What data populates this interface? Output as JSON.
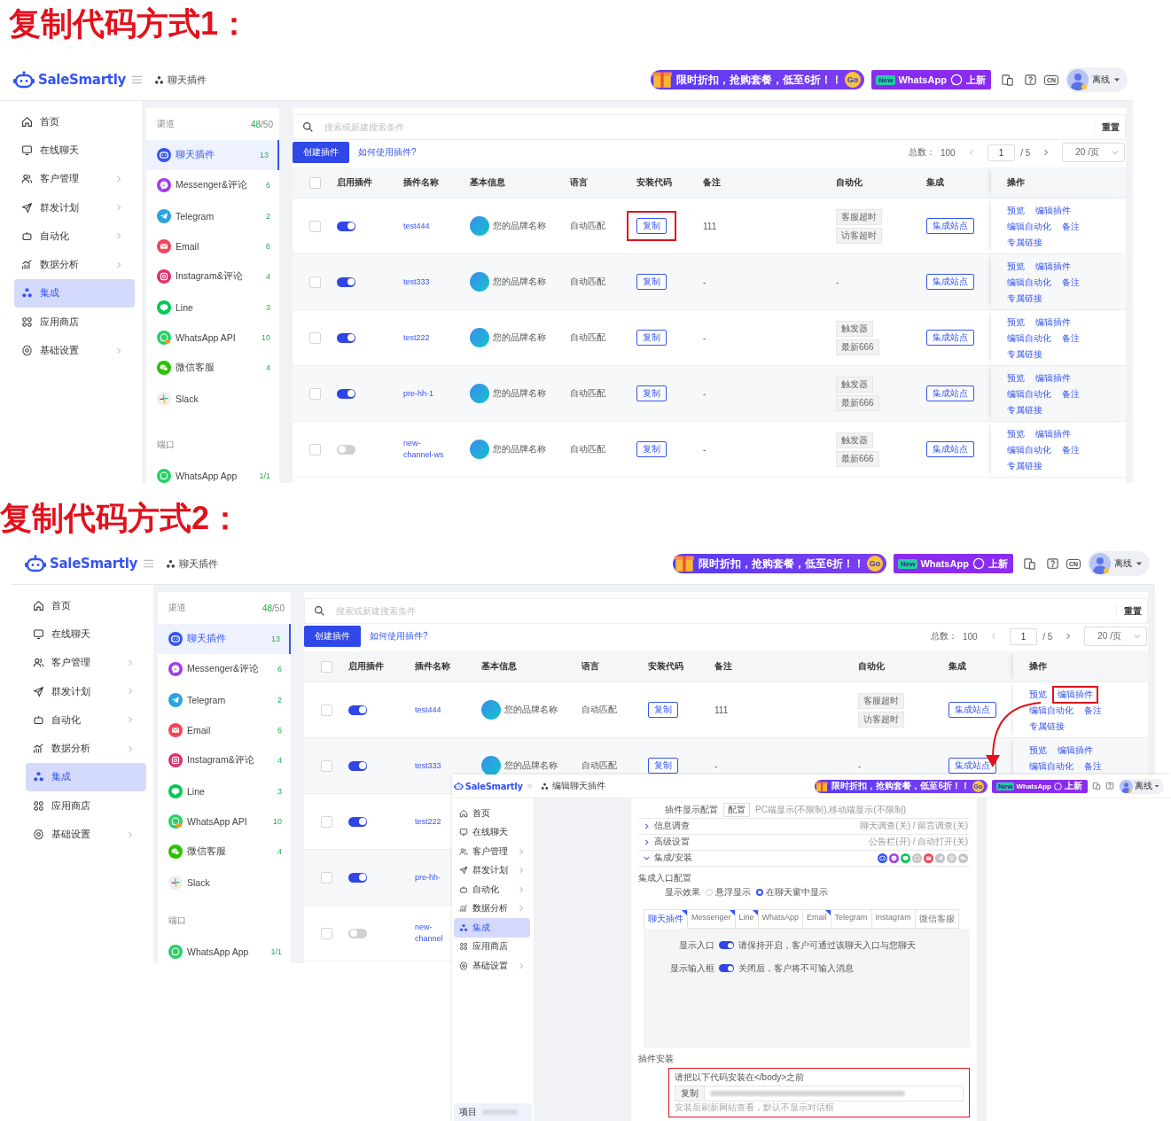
{
  "headings": [
    "复制代码方式1：",
    "复制代码方式2："
  ],
  "screens": [
    {
      "brand": "SaleSmartly",
      "breadcrumb": "聊天插件",
      "promo": {
        "text": "限时折扣，抢购套餐，低至6折！！",
        "go": "Go"
      },
      "whatsapp_promo": {
        "badge": "New",
        "text": "WhatsApp",
        "suffix": "上新"
      },
      "language": "CN",
      "user_status": "离线",
      "nav": [
        {
          "kind": "home",
          "label": "首页",
          "has_submenu": false,
          "selected": false
        },
        {
          "kind": "chat",
          "label": "在线聊天",
          "has_submenu": false,
          "selected": false
        },
        {
          "kind": "users",
          "label": "客户管理",
          "has_submenu": true,
          "selected": false
        },
        {
          "kind": "send",
          "label": "群发计划",
          "has_submenu": true,
          "selected": false
        },
        {
          "kind": "robot",
          "label": "自动化",
          "has_submenu": true,
          "selected": false
        },
        {
          "kind": "chart",
          "label": "数据分析",
          "has_submenu": true,
          "selected": false
        },
        {
          "kind": "integration",
          "label": "集成",
          "has_submenu": false,
          "selected": true
        },
        {
          "kind": "apps",
          "label": "应用商店",
          "has_submenu": false,
          "selected": false
        },
        {
          "kind": "settings",
          "label": "基础设置",
          "has_submenu": true,
          "selected": false
        }
      ],
      "channels": {
        "title": "渠道",
        "used": "48",
        "limit": "/50",
        "items": [
          {
            "kind": "chat",
            "label": "聊天插件",
            "count": "13",
            "selected": true
          },
          {
            "kind": "messenger",
            "label": "Messenger&评论",
            "count": "6",
            "selected": false
          },
          {
            "kind": "telegram",
            "label": "Telegram",
            "count": "2",
            "selected": false
          },
          {
            "kind": "email",
            "label": "Email",
            "count": "6",
            "selected": false
          },
          {
            "kind": "instagram",
            "label": "Instagram&评论",
            "count": "4",
            "selected": false
          },
          {
            "kind": "line",
            "label": "Line",
            "count": "3",
            "selected": false
          },
          {
            "kind": "whatsappapi",
            "label": "WhatsApp API",
            "count": "10",
            "selected": false
          },
          {
            "kind": "wechat",
            "label": "微信客服",
            "count": "4",
            "selected": false
          },
          {
            "kind": "slack",
            "label": "Slack",
            "selected": false
          }
        ],
        "ports_title": "端口",
        "ports": [
          {
            "kind": "whatsapp",
            "label": "WhatsApp App",
            "count": "1/1",
            "selected": false
          }
        ]
      },
      "search": {
        "placeholder": "搜索或新建搜索条件",
        "reset": "重置"
      },
      "create_button": "创建插件",
      "help_link": "如何使用插件?",
      "pagination": {
        "total_label": "总数：",
        "total": "100",
        "page": "1",
        "pages": "/ 5",
        "page_size": "20 /页"
      },
      "all_checked": false,
      "columns": [
        "启用插件",
        "插件名称",
        "基本信息",
        "语言",
        "安装代码",
        "备注",
        "自动化",
        "集成",
        "操作"
      ],
      "rows": [
        {
          "checked": false,
          "enabled": true,
          "name": "test444",
          "brand": "您的品牌名称",
          "language": "自动匹配",
          "install": {
            "label": "复制",
            "highlighted": true
          },
          "note": "111",
          "automation": [
            "客服超时",
            "访客超时"
          ],
          "integration": "集成站点",
          "actions": [
            {
              "label": "预览",
              "highlighted": false
            },
            {
              "label": "编辑插件",
              "highlighted": false
            },
            {
              "label": "编辑自动化",
              "highlighted": false
            },
            {
              "label": "备注",
              "highlighted": false
            },
            {
              "label": "专属链接",
              "highlighted": false
            }
          ]
        },
        {
          "checked": false,
          "enabled": true,
          "name": "test333",
          "brand": "您的品牌名称",
          "language": "自动匹配",
          "install": {
            "label": "复制",
            "highlighted": false
          },
          "note": "-",
          "automation": "-",
          "integration": "集成站点",
          "actions": [
            {
              "label": "预览",
              "highlighted": false
            },
            {
              "label": "编辑插件",
              "highlighted": false
            },
            {
              "label": "编辑自动化",
              "highlighted": false
            },
            {
              "label": "备注",
              "highlighted": false
            },
            {
              "label": "专属链接",
              "highlighted": false
            }
          ]
        },
        {
          "checked": false,
          "enabled": true,
          "name": "test222",
          "brand": "您的品牌名称",
          "language": "自动匹配",
          "install": {
            "label": "复制",
            "highlighted": false
          },
          "note": "-",
          "automation": [
            "触发器",
            "最新666"
          ],
          "integration": "集成站点",
          "actions": [
            {
              "label": "预览",
              "highlighted": false
            },
            {
              "label": "编辑插件",
              "highlighted": false
            },
            {
              "label": "编辑自动化",
              "highlighted": false
            },
            {
              "label": "备注",
              "highlighted": false
            },
            {
              "label": "专属链接",
              "highlighted": false
            }
          ]
        },
        {
          "checked": false,
          "enabled": true,
          "name": "pre-hh-1",
          "brand": "您的品牌名称",
          "language": "自动匹配",
          "install": {
            "label": "复制",
            "highlighted": false
          },
          "note": "-",
          "automation": [
            "触发器",
            "最新666"
          ],
          "integration": "集成站点",
          "actions": [
            {
              "label": "预览",
              "highlighted": false
            },
            {
              "label": "编辑插件",
              "highlighted": false
            },
            {
              "label": "编辑自动化",
              "highlighted": false
            },
            {
              "label": "备注",
              "highlighted": false
            },
            {
              "label": "专属链接",
              "highlighted": false
            }
          ]
        },
        {
          "checked": false,
          "enabled": false,
          "name": "new-channel-ws",
          "brand": "您的品牌名称",
          "language": "自动匹配",
          "install": {
            "label": "复制",
            "highlighted": false
          },
          "note": "-",
          "automation": [
            "触发器",
            "最新666"
          ],
          "integration": "集成站点",
          "actions": [
            {
              "label": "预览",
              "highlighted": false
            },
            {
              "label": "编辑插件",
              "highlighted": false
            },
            {
              "label": "编辑自动化",
              "highlighted": false
            },
            {
              "label": "备注",
              "highlighted": false
            },
            {
              "label": "专属链接",
              "highlighted": false
            }
          ]
        }
      ]
    },
    {
      "brand": "SaleSmartly",
      "breadcrumb": "聊天插件",
      "promo": {
        "text": "限时折扣，抢购套餐，低至6折！！",
        "go": "Go"
      },
      "whatsapp_promo": {
        "badge": "New",
        "text": "WhatsApp",
        "suffix": "上新"
      },
      "language": "CN",
      "user_status": "离线",
      "nav": [
        {
          "kind": "home",
          "label": "首页",
          "has_submenu": false,
          "selected": false
        },
        {
          "kind": "chat",
          "label": "在线聊天",
          "has_submenu": false,
          "selected": false
        },
        {
          "kind": "users",
          "label": "客户管理",
          "has_submenu": true,
          "selected": false
        },
        {
          "kind": "send",
          "label": "群发计划",
          "has_submenu": true,
          "selected": false
        },
        {
          "kind": "robot",
          "label": "自动化",
          "has_submenu": true,
          "selected": false
        },
        {
          "kind": "chart",
          "label": "数据分析",
          "has_submenu": true,
          "selected": false
        },
        {
          "kind": "integration",
          "label": "集成",
          "has_submenu": false,
          "selected": true
        },
        {
          "kind": "apps",
          "label": "应用商店",
          "has_submenu": false,
          "selected": false
        },
        {
          "kind": "settings",
          "label": "基础设置",
          "has_submenu": true,
          "selected": false
        }
      ],
      "channels": {
        "title": "渠道",
        "used": "48",
        "limit": "/50",
        "items": [
          {
            "kind": "chat",
            "label": "聊天插件",
            "count": "13",
            "selected": true
          },
          {
            "kind": "messenger",
            "label": "Messenger&评论",
            "count": "6",
            "selected": false
          },
          {
            "kind": "telegram",
            "label": "Telegram",
            "count": "2",
            "selected": false
          },
          {
            "kind": "email",
            "label": "Email",
            "count": "6",
            "selected": false
          },
          {
            "kind": "instagram",
            "label": "Instagram&评论",
            "count": "4",
            "selected": false
          },
          {
            "kind": "line",
            "label": "Line",
            "count": "3",
            "selected": false
          },
          {
            "kind": "whatsappapi",
            "label": "WhatsApp API",
            "count": "10",
            "selected": false
          },
          {
            "kind": "wechat",
            "label": "微信客服",
            "count": "4",
            "selected": false
          },
          {
            "kind": "slack",
            "label": "Slack",
            "selected": false
          }
        ],
        "ports_title": "端口",
        "ports": [
          {
            "kind": "whatsapp",
            "label": "WhatsApp App",
            "count": "1/1",
            "selected": false
          }
        ]
      },
      "search": {
        "placeholder": "搜索或新建搜索条件",
        "reset": "重置"
      },
      "create_button": "创建插件",
      "help_link": "如何使用插件?",
      "pagination": {
        "total_label": "总数：",
        "total": "100",
        "page": "1",
        "pages": "/ 5",
        "page_size": "20 /页"
      },
      "all_checked": false,
      "columns": [
        "启用插件",
        "插件名称",
        "基本信息",
        "语言",
        "安装代码",
        "备注",
        "自动化",
        "集成",
        "操作"
      ],
      "rows": [
        {
          "checked": false,
          "enabled": true,
          "name": "test444",
          "brand": "您的品牌名称",
          "language": "自动匹配",
          "install": {
            "label": "复制",
            "highlighted": false
          },
          "note": "111",
          "automation": [
            "客服超时",
            "访客超时"
          ],
          "integration": "集成站点",
          "actions": [
            {
              "label": "预览",
              "highlighted": false
            },
            {
              "label": "编辑插件",
              "highlighted": true
            },
            {
              "label": "编辑自动化",
              "highlighted": false
            },
            {
              "label": "备注",
              "highlighted": false
            },
            {
              "label": "专属链接",
              "highlighted": false
            }
          ]
        },
        {
          "checked": false,
          "enabled": true,
          "name": "test333",
          "brand": "您的品牌名称",
          "language": "自动匹配",
          "install": {
            "label": "复制",
            "highlighted": false
          },
          "note": "-",
          "automation": "-",
          "integration": "集成站点",
          "actions": [
            {
              "label": "预览",
              "highlighted": false
            },
            {
              "label": "编辑插件",
              "highlighted": false
            },
            {
              "label": "编辑自动化",
              "highlighted": false
            },
            {
              "label": "备注",
              "highlighted": false
            }
          ]
        },
        {
          "checked": false,
          "enabled": true,
          "name": "test222"
        },
        {
          "checked": false,
          "enabled": true,
          "name": "pre-hh-"
        },
        {
          "checked": false,
          "enabled": false,
          "name": "new-channel"
        }
      ]
    }
  ],
  "edit_screen": {
    "brand": "SaleSmartly",
    "breadcrumb": "编辑聊天插件",
    "promo": {
      "text": "限时折扣，抢购套餐，低至6折！！",
      "go": "Go"
    },
    "whatsapp_promo": {
      "badge": "New",
      "text": "WhatsApp",
      "suffix": "上新"
    },
    "user_status": "离线",
    "nav": [
      {
        "kind": "home",
        "label": "首页",
        "has_submenu": false,
        "selected": false
      },
      {
        "kind": "chat",
        "label": "在线聊天",
        "has_submenu": false,
        "selected": false
      },
      {
        "kind": "users",
        "label": "客户管理",
        "has_submenu": true,
        "selected": false
      },
      {
        "kind": "send",
        "label": "群发计划",
        "has_submenu": true,
        "selected": false
      },
      {
        "kind": "robot",
        "label": "自动化",
        "has_submenu": true,
        "selected": false
      },
      {
        "kind": "chart",
        "label": "数据分析",
        "has_submenu": true,
        "selected": false
      },
      {
        "kind": "integration",
        "label": "集成",
        "has_submenu": false,
        "selected": true
      },
      {
        "kind": "apps",
        "label": "应用商店",
        "has_submenu": false,
        "selected": false
      },
      {
        "kind": "settings",
        "label": "基础设置",
        "has_submenu": true,
        "selected": false
      }
    ],
    "project_label": "项目",
    "display_config": {
      "label": "插件显示配置",
      "button": "配置",
      "value": "PC端显示(不限制),移动端显示(不限制)"
    },
    "sections": [
      {
        "title": "信息调查",
        "summary": "聊天调查(关) / 留言调查(关)",
        "expanded": false
      },
      {
        "title": "高级设置",
        "summary": "公告栏(开) / 自动打开(关)",
        "expanded": false
      },
      {
        "title": "集成/安装",
        "expanded": true,
        "channels": [
          {
            "kind": "chat",
            "enabled": true
          },
          {
            "kind": "messenger",
            "enabled": true
          },
          {
            "kind": "line",
            "enabled": true
          },
          {
            "kind": "whatsapp",
            "enabled": false
          },
          {
            "kind": "email",
            "enabled": true
          },
          {
            "kind": "telegram",
            "enabled": false
          },
          {
            "kind": "instagram",
            "enabled": false
          },
          {
            "kind": "wechat",
            "enabled": false
          }
        ]
      }
    ],
    "entry_config": {
      "title": "集成入口配置",
      "effect_label": "显示效果",
      "options": [
        {
          "label": "悬浮显示",
          "selected": false
        },
        {
          "label": "在聊天窗中显示",
          "selected": true
        }
      ]
    },
    "tabs": [
      {
        "label": "聊天插件",
        "selected": true,
        "flagged": true
      },
      {
        "label": "Messenger",
        "selected": false,
        "flagged": true
      },
      {
        "label": "Line",
        "selected": false,
        "flagged": true
      },
      {
        "label": "WhatsApp",
        "selected": false,
        "flagged": false
      },
      {
        "label": "Email",
        "selected": false,
        "flagged": true
      },
      {
        "label": "Telegram",
        "selected": false,
        "flagged": false
      },
      {
        "label": "Instagram",
        "selected": false,
        "flagged": false
      },
      {
        "label": "微信客服",
        "selected": false,
        "flagged": false
      }
    ],
    "toggles": [
      {
        "label": "显示入口",
        "on": true,
        "description": "请保持开启，客户可通过该聊天入口与您聊天"
      },
      {
        "label": "显示输入框",
        "on": true,
        "description": "关闭后，客户将不可输入消息"
      }
    ],
    "install": {
      "title": "插件安装",
      "instruction": "请把以下代码安装在</body>之前",
      "copy": "复制",
      "hint": "安装后刷新网站查看，默认不显示对话框",
      "highlighted": true
    }
  }
}
